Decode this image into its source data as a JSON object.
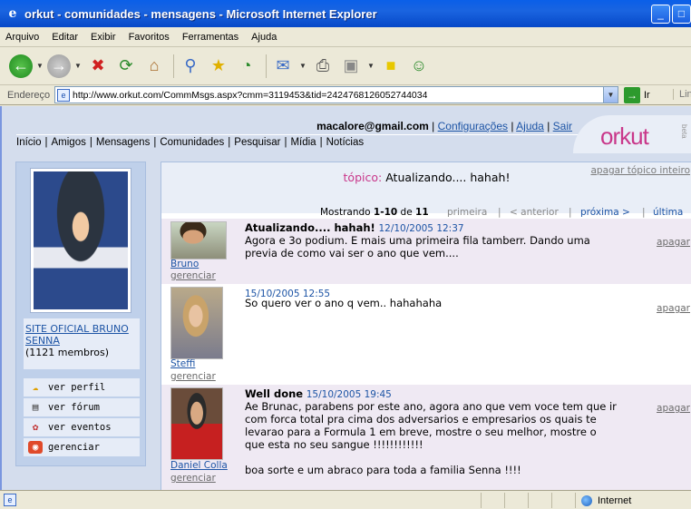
{
  "window": {
    "title": "orkut - comunidades - mensagens - Microsoft Internet Explorer",
    "app_icon": "e"
  },
  "menu": [
    "Arquivo",
    "Editar",
    "Exibir",
    "Favoritos",
    "Ferramentas",
    "Ajuda"
  ],
  "address": {
    "label": "Endereço",
    "url": "http://www.orkut.com/CommMsgs.aspx?cmm=3119453&tid=2424768126052744034",
    "go_label": "Ir",
    "links_label": "Links"
  },
  "header": {
    "user_email": "macalore@gmail.com",
    "links": [
      "Configurações",
      "Ajuda",
      "Sair"
    ],
    "nav": [
      "Início",
      "Amigos",
      "Mensagens",
      "Comunidades",
      "Pesquisar",
      "Mídia",
      "Notícias"
    ],
    "logo": "orkut",
    "beta": "beta"
  },
  "community": {
    "name": "SITE OFICIAL BRUNO SENNA",
    "members": "(1121 membros)",
    "actions": [
      {
        "label": "ver perfil",
        "icon": "profile-icon"
      },
      {
        "label": "ver fórum",
        "icon": "forum-icon"
      },
      {
        "label": "ver eventos",
        "icon": "events-icon"
      },
      {
        "label": "gerenciar",
        "icon": "manage-icon"
      }
    ]
  },
  "topic": {
    "label": "tópico:",
    "title": "Atualizando.... hahah!",
    "delete_topic": "apagar tópico inteiro"
  },
  "pager": {
    "showing_prefix": "Mostrando",
    "range": "1-10",
    "of": "de",
    "total": "11",
    "first": "primeira",
    "prev": "< anterior",
    "next": "próxima >",
    "last": "última"
  },
  "messages": [
    {
      "author": "Bruno",
      "manage": "gerenciar",
      "title": "Atualizando.... hahah!",
      "date": "12/10/2005 12:37",
      "body": "Agora e 3o podium. E mais uma primeira fila tamberr. Dando uma\nprevia de como vai ser o ano que vem....",
      "delete": "apagar"
    },
    {
      "author": "Steffi",
      "manage": "gerenciar",
      "title": "",
      "date": "15/10/2005 12:55",
      "body": "So quero ver o ano q vem.. hahahaha",
      "delete": "apagar"
    },
    {
      "author": "Daniel Colla",
      "manage": "gerenciar",
      "title": "Well done",
      "date": "15/10/2005 19:45",
      "body": "Ae Brunac, parabens por este ano, agora ano que vem voce tem que ir\ncom forca total pra cima dos adversarios e empresarios os quais te\nlevarao para a Formula 1 em breve, mostre o seu melhor, mostre o\nque esta no seu sangue !!!!!!!!!!!!\n\nboa sorte e um abraco para toda a familia Senna !!!!",
      "delete": "apagar"
    }
  ],
  "status": {
    "zone": "Internet"
  }
}
